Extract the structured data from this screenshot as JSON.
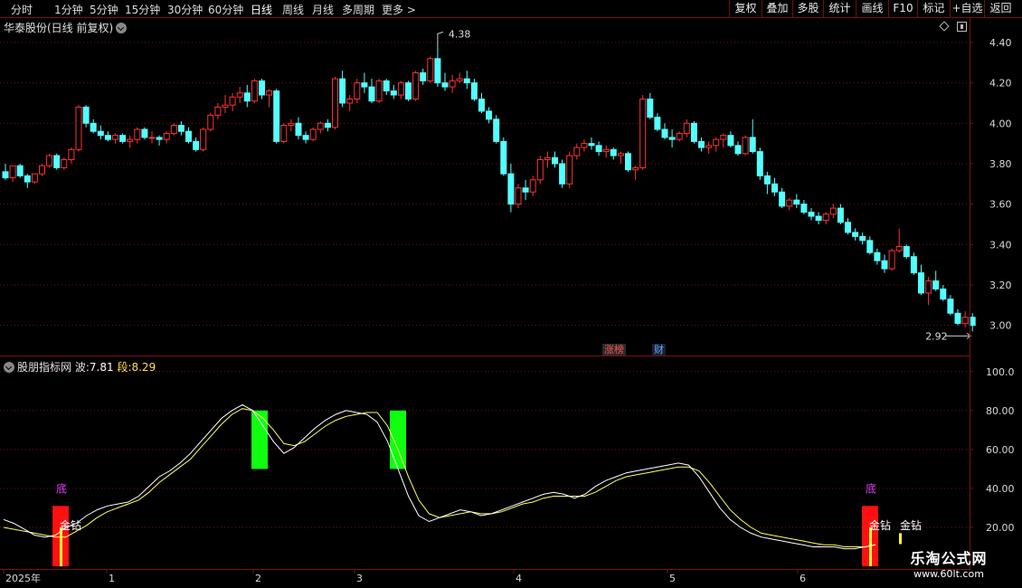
{
  "toolbar": {
    "timeframes": [
      "分时",
      "1分钟",
      "5分钟",
      "15分钟",
      "30分钟",
      "60分钟",
      "日线",
      "周线",
      "月线",
      "多周期",
      "更多"
    ],
    "active": "日线",
    "right_buttons": [
      "复权",
      "叠加",
      "多股",
      "统计",
      "画线",
      "F10",
      "标记",
      "+自选",
      "返回"
    ]
  },
  "main": {
    "title": "华泰股份(日线 前复权)",
    "high_label": "4.38",
    "low_label": "2.92",
    "badges": {
      "limit_list": "涨榜",
      "finance": "财"
    },
    "price_axis": [
      "4.40",
      "4.20",
      "4.00",
      "3.80",
      "3.60",
      "3.40",
      "3.20",
      "3.00"
    ]
  },
  "indicator": {
    "name": "股朋指标网",
    "wave_label": "波:",
    "wave_value": "7.81",
    "segment_label": "段:",
    "segment_value": "8.29",
    "axis": [
      "100.0",
      "80.00",
      "60.00",
      "40.00",
      "20.00"
    ],
    "signal_bottom": "底",
    "signal_diamond": "金钻"
  },
  "time_axis": {
    "labels": [
      "2025年",
      "1",
      "2",
      "3",
      "4",
      "5",
      "6"
    ]
  },
  "colors": {
    "up": "#ff3232",
    "down": "#54ffff",
    "wave": "#ffffff",
    "segment": "#ffff66",
    "buy_bar": "#ff1010",
    "sell_bar": "#10ff10",
    "grid": "#7a1010"
  },
  "watermark": {
    "name": "乐淘公式网",
    "url": "www.60lt.com"
  },
  "chart_data": {
    "type": "candlestick",
    "ylim": [
      2.9,
      4.44
    ],
    "candles": [
      [
        3.76,
        3.8,
        3.72,
        3.73
      ],
      [
        3.73,
        3.79,
        3.71,
        3.79
      ],
      [
        3.79,
        3.8,
        3.73,
        3.74
      ],
      [
        3.74,
        3.75,
        3.68,
        3.71
      ],
      [
        3.71,
        3.75,
        3.7,
        3.75
      ],
      [
        3.75,
        3.8,
        3.74,
        3.79
      ],
      [
        3.79,
        3.85,
        3.78,
        3.84
      ],
      [
        3.84,
        3.85,
        3.77,
        3.78
      ],
      [
        3.78,
        3.83,
        3.77,
        3.82
      ],
      [
        3.82,
        3.88,
        3.8,
        3.87
      ],
      [
        3.87,
        4.09,
        3.86,
        4.08
      ],
      [
        4.08,
        4.09,
        3.98,
        4.0
      ],
      [
        4.0,
        4.02,
        3.95,
        3.96
      ],
      [
        3.96,
        3.99,
        3.92,
        3.94
      ],
      [
        3.94,
        3.96,
        3.91,
        3.92
      ],
      [
        3.92,
        3.95,
        3.9,
        3.94
      ],
      [
        3.94,
        3.95,
        3.9,
        3.91
      ],
      [
        3.91,
        3.94,
        3.88,
        3.92
      ],
      [
        3.92,
        3.98,
        3.9,
        3.97
      ],
      [
        3.97,
        3.98,
        3.92,
        3.93
      ],
      [
        3.93,
        3.96,
        3.9,
        3.93
      ],
      [
        3.93,
        3.94,
        3.89,
        3.92
      ],
      [
        3.92,
        3.96,
        3.9,
        3.95
      ],
      [
        3.95,
        4.0,
        3.94,
        3.99
      ],
      [
        3.99,
        4.01,
        3.94,
        3.96
      ],
      [
        3.96,
        3.98,
        3.9,
        3.91
      ],
      [
        3.91,
        3.93,
        3.86,
        3.87
      ],
      [
        3.87,
        3.98,
        3.86,
        3.97
      ],
      [
        3.97,
        4.05,
        3.96,
        4.04
      ],
      [
        4.04,
        4.1,
        4.02,
        4.08
      ],
      [
        4.08,
        4.14,
        4.05,
        4.09
      ],
      [
        4.09,
        4.15,
        4.06,
        4.13
      ],
      [
        4.13,
        4.18,
        4.1,
        4.15
      ],
      [
        4.15,
        4.19,
        4.08,
        4.11
      ],
      [
        4.11,
        4.22,
        4.1,
        4.21
      ],
      [
        4.21,
        4.22,
        4.12,
        4.14
      ],
      [
        4.14,
        4.17,
        4.08,
        4.16
      ],
      [
        4.16,
        4.17,
        3.9,
        3.91
      ],
      [
        3.91,
        4.0,
        3.9,
        3.99
      ],
      [
        3.99,
        4.02,
        3.96,
        4.0
      ],
      [
        4.0,
        4.03,
        3.92,
        3.94
      ],
      [
        3.94,
        3.96,
        3.9,
        3.92
      ],
      [
        3.92,
        3.98,
        3.91,
        3.97
      ],
      [
        3.97,
        4.01,
        3.95,
        4.0
      ],
      [
        4.0,
        4.02,
        3.96,
        3.98
      ],
      [
        3.98,
        4.23,
        3.97,
        4.22
      ],
      [
        4.22,
        4.26,
        4.08,
        4.1
      ],
      [
        4.1,
        4.14,
        4.06,
        4.12
      ],
      [
        4.12,
        4.22,
        4.1,
        4.2
      ],
      [
        4.2,
        4.25,
        4.15,
        4.18
      ],
      [
        4.18,
        4.22,
        4.1,
        4.11
      ],
      [
        4.11,
        4.22,
        4.1,
        4.21
      ],
      [
        4.21,
        4.22,
        4.14,
        4.16
      ],
      [
        4.16,
        4.19,
        4.12,
        4.14
      ],
      [
        4.14,
        4.21,
        4.12,
        4.2
      ],
      [
        4.2,
        4.21,
        4.11,
        4.12
      ],
      [
        4.12,
        4.26,
        4.11,
        4.25
      ],
      [
        4.25,
        4.27,
        4.19,
        4.21
      ],
      [
        4.21,
        4.33,
        4.2,
        4.32
      ],
      [
        4.32,
        4.38,
        4.18,
        4.2
      ],
      [
        4.2,
        4.25,
        4.16,
        4.18
      ],
      [
        4.18,
        4.24,
        4.15,
        4.21
      ],
      [
        4.21,
        4.25,
        4.2,
        4.22
      ],
      [
        4.22,
        4.26,
        4.17,
        4.2
      ],
      [
        4.2,
        4.22,
        4.11,
        4.12
      ],
      [
        4.12,
        4.15,
        4.05,
        4.06
      ],
      [
        4.06,
        4.08,
        4.0,
        4.02
      ],
      [
        4.02,
        4.04,
        3.9,
        3.91
      ],
      [
        3.91,
        3.93,
        3.74,
        3.75
      ],
      [
        3.75,
        3.8,
        3.56,
        3.6
      ],
      [
        3.6,
        3.7,
        3.58,
        3.68
      ],
      [
        3.68,
        3.72,
        3.62,
        3.66
      ],
      [
        3.66,
        3.74,
        3.64,
        3.72
      ],
      [
        3.72,
        3.84,
        3.7,
        3.82
      ],
      [
        3.82,
        3.86,
        3.78,
        3.83
      ],
      [
        3.83,
        3.86,
        3.78,
        3.8
      ],
      [
        3.8,
        3.82,
        3.68,
        3.7
      ],
      [
        3.7,
        3.86,
        3.68,
        3.84
      ],
      [
        3.84,
        3.9,
        3.82,
        3.88
      ],
      [
        3.88,
        3.92,
        3.86,
        3.9
      ],
      [
        3.9,
        3.93,
        3.87,
        3.89
      ],
      [
        3.89,
        3.91,
        3.84,
        3.86
      ],
      [
        3.86,
        3.89,
        3.83,
        3.87
      ],
      [
        3.87,
        3.88,
        3.82,
        3.84
      ],
      [
        3.84,
        3.86,
        3.8,
        3.85
      ],
      [
        3.85,
        3.86,
        3.76,
        3.77
      ],
      [
        3.77,
        3.79,
        3.72,
        3.78
      ],
      [
        3.78,
        4.14,
        3.77,
        4.12
      ],
      [
        4.12,
        4.15,
        4.02,
        4.03
      ],
      [
        4.03,
        4.05,
        3.96,
        3.97
      ],
      [
        3.97,
        4.0,
        3.92,
        3.93
      ],
      [
        3.93,
        3.97,
        3.88,
        3.92
      ],
      [
        3.92,
        3.96,
        3.91,
        3.95
      ],
      [
        3.95,
        4.02,
        3.93,
        4.0
      ],
      [
        4.0,
        4.01,
        3.9,
        3.91
      ],
      [
        3.91,
        3.93,
        3.86,
        3.88
      ],
      [
        3.88,
        3.91,
        3.85,
        3.89
      ],
      [
        3.89,
        3.93,
        3.86,
        3.92
      ],
      [
        3.92,
        3.95,
        3.88,
        3.94
      ],
      [
        3.94,
        3.96,
        3.88,
        3.89
      ],
      [
        3.89,
        3.91,
        3.84,
        3.85
      ],
      [
        3.85,
        3.94,
        3.84,
        3.93
      ],
      [
        3.93,
        4.02,
        3.85,
        3.86
      ],
      [
        3.86,
        3.88,
        3.72,
        3.74
      ],
      [
        3.74,
        3.76,
        3.65,
        3.7
      ],
      [
        3.7,
        3.73,
        3.64,
        3.66
      ],
      [
        3.66,
        3.68,
        3.58,
        3.59
      ],
      [
        3.59,
        3.63,
        3.57,
        3.62
      ],
      [
        3.62,
        3.65,
        3.58,
        3.6
      ],
      [
        3.6,
        3.62,
        3.55,
        3.56
      ],
      [
        3.56,
        3.58,
        3.52,
        3.54
      ],
      [
        3.54,
        3.56,
        3.5,
        3.52
      ],
      [
        3.52,
        3.56,
        3.5,
        3.55
      ],
      [
        3.55,
        3.6,
        3.53,
        3.58
      ],
      [
        3.58,
        3.6,
        3.5,
        3.51
      ],
      [
        3.51,
        3.53,
        3.45,
        3.46
      ],
      [
        3.46,
        3.48,
        3.42,
        3.44
      ],
      [
        3.44,
        3.46,
        3.4,
        3.42
      ],
      [
        3.42,
        3.44,
        3.35,
        3.36
      ],
      [
        3.36,
        3.38,
        3.3,
        3.32
      ],
      [
        3.32,
        3.35,
        3.26,
        3.28
      ],
      [
        3.28,
        3.38,
        3.27,
        3.37
      ],
      [
        3.37,
        3.48,
        3.36,
        3.39
      ],
      [
        3.39,
        3.4,
        3.33,
        3.34
      ],
      [
        3.34,
        3.36,
        3.25,
        3.26
      ],
      [
        3.26,
        3.3,
        3.15,
        3.16
      ],
      [
        3.16,
        3.24,
        3.1,
        3.22
      ],
      [
        3.22,
        3.27,
        3.17,
        3.18
      ],
      [
        3.18,
        3.2,
        3.12,
        3.13
      ],
      [
        3.13,
        3.15,
        3.05,
        3.06
      ],
      [
        3.06,
        3.08,
        3.0,
        3.01
      ],
      [
        3.01,
        3.07,
        2.99,
        3.04
      ],
      [
        3.04,
        3.06,
        2.97,
        3.0
      ]
    ],
    "indicator": {
      "ylim": [
        0,
        105
      ],
      "wave": [
        24,
        22,
        19,
        16,
        15,
        16,
        20,
        22,
        26,
        29,
        31,
        32,
        33,
        36,
        41,
        46,
        49,
        53,
        58,
        64,
        70,
        76,
        80,
        83,
        80,
        72,
        64,
        58,
        61,
        66,
        71,
        75,
        78,
        80,
        79,
        78,
        74,
        64,
        50,
        36,
        26,
        23,
        25,
        27,
        29,
        28,
        26,
        27,
        29,
        31,
        33,
        35,
        37,
        38,
        37,
        35,
        37,
        41,
        44,
        46,
        48,
        49,
        50,
        51,
        52,
        53,
        52,
        46,
        38,
        30,
        24,
        20,
        17,
        15,
        14,
        13,
        12,
        11,
        10,
        10,
        10,
        9,
        9,
        10,
        11
      ],
      "segment": [
        20,
        19,
        18,
        17,
        16,
        15,
        15,
        18,
        21,
        25,
        28,
        30,
        32,
        34,
        38,
        43,
        47,
        51,
        55,
        61,
        67,
        73,
        78,
        81,
        80,
        76,
        70,
        63,
        62,
        64,
        68,
        72,
        75,
        77,
        78,
        79,
        79,
        72,
        60,
        46,
        34,
        27,
        25,
        26,
        27,
        28,
        27,
        27,
        28,
        30,
        32,
        33,
        35,
        36,
        36,
        36,
        36,
        38,
        41,
        44,
        46,
        47,
        48,
        49,
        50,
        51,
        51,
        49,
        43,
        36,
        29,
        24,
        20,
        17,
        16,
        15,
        14,
        13,
        12,
        11,
        11,
        10,
        10,
        10,
        11
      ]
    },
    "signals": [
      {
        "type": "bottom",
        "index": 12
      },
      {
        "type": "top",
        "index": 55
      },
      {
        "type": "top",
        "index": 86
      },
      {
        "type": "bottom",
        "index": 130
      }
    ]
  }
}
